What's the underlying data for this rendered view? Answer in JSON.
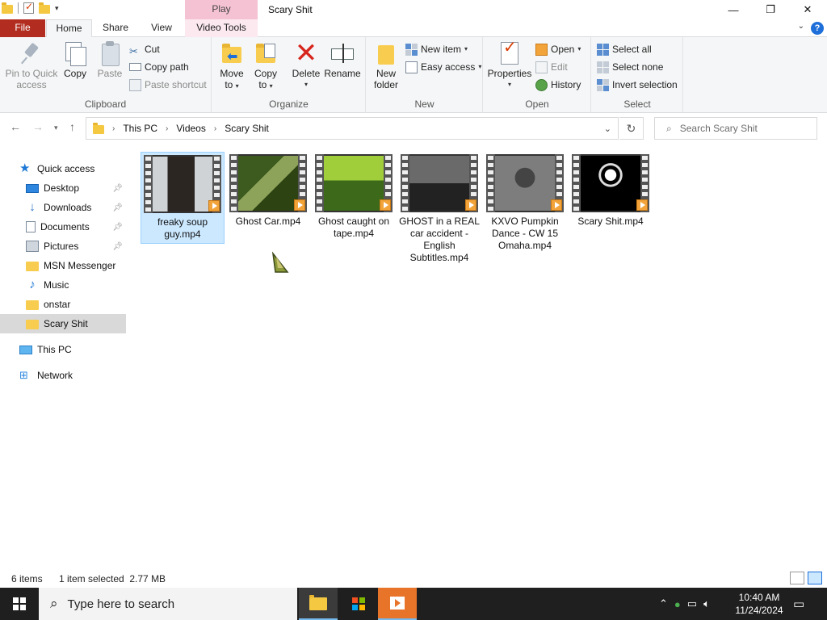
{
  "window": {
    "title": "Scary Shit",
    "contextual_tab_header": "Play",
    "controls": {
      "minimize": "—",
      "maximize": "❐",
      "close": "✕"
    }
  },
  "ribbon_tabs": [
    "File",
    "Home",
    "Share",
    "View",
    "Video Tools"
  ],
  "ribbon": {
    "clipboard": {
      "label": "Clipboard",
      "pin": "Pin to Quick access",
      "pin_line1": "Pin to Quick",
      "pin_line2": "access",
      "copy": "Copy",
      "paste": "Paste",
      "cut": "Cut",
      "copy_path": "Copy path",
      "paste_shortcut": "Paste shortcut"
    },
    "organize": {
      "label": "Organize",
      "move_to_1": "Move",
      "move_to_2": "to",
      "copy_to_1": "Copy",
      "copy_to_2": "to",
      "delete": "Delete",
      "rename": "Rename"
    },
    "new": {
      "label": "New",
      "new_folder_1": "New",
      "new_folder_2": "folder",
      "new_item": "New item",
      "easy_access": "Easy access"
    },
    "open": {
      "label": "Open",
      "properties": "Properties",
      "open": "Open",
      "edit": "Edit",
      "history": "History"
    },
    "select": {
      "label": "Select",
      "select_all": "Select all",
      "select_none": "Select none",
      "invert": "Invert selection"
    }
  },
  "address": {
    "breadcrumbs": [
      "This PC",
      "Videos",
      "Scary Shit"
    ],
    "search_placeholder": "Search Scary Shit"
  },
  "sidebar": {
    "items": [
      {
        "label": "Quick access",
        "icon": "star-icon"
      },
      {
        "label": "Desktop",
        "icon": "desktop-icon",
        "pinned": true
      },
      {
        "label": "Downloads",
        "icon": "download-icon",
        "pinned": true
      },
      {
        "label": "Documents",
        "icon": "document-icon",
        "pinned": true
      },
      {
        "label": "Pictures",
        "icon": "pictures-icon",
        "pinned": true
      },
      {
        "label": "MSN Messenger",
        "icon": "folder-icon"
      },
      {
        "label": "Music",
        "icon": "music-icon"
      },
      {
        "label": "onstar",
        "icon": "folder-icon"
      },
      {
        "label": "Scary Shit",
        "icon": "folder-icon",
        "selected": true
      },
      {
        "label": "This PC",
        "icon": "pc-icon"
      },
      {
        "label": "Network",
        "icon": "network-icon"
      }
    ]
  },
  "files": [
    {
      "name": "freaky soup guy.mp4",
      "selected": true,
      "colors": [
        "#cfd3d6",
        "#2b2622"
      ]
    },
    {
      "name": "Ghost Car.mp4",
      "selected": false,
      "colors": [
        "#3d5a1f",
        "#8da35a"
      ]
    },
    {
      "name": "Ghost caught on tape.mp4",
      "selected": false,
      "colors": [
        "#3d6a1a",
        "#9fce3a"
      ]
    },
    {
      "name": "GHOST in a REAL car accident - English Subtitles.mp4",
      "selected": false,
      "colors": [
        "#222222",
        "#6a6a6a"
      ]
    },
    {
      "name": "KXVO Pumpkin Dance - CW 15 Omaha.mp4",
      "selected": false,
      "colors": [
        "#7d7d7d",
        "#444444"
      ]
    },
    {
      "name": "Scary Shit.mp4",
      "selected": false,
      "colors": [
        "#000000",
        "#ffffff"
      ]
    }
  ],
  "status": {
    "item_count": "6 items",
    "selection": "1 item selected  2.77 MB"
  },
  "taskbar": {
    "search_placeholder": "Type here to search",
    "time": "10:40 AM",
    "date": "11/24/2024"
  }
}
